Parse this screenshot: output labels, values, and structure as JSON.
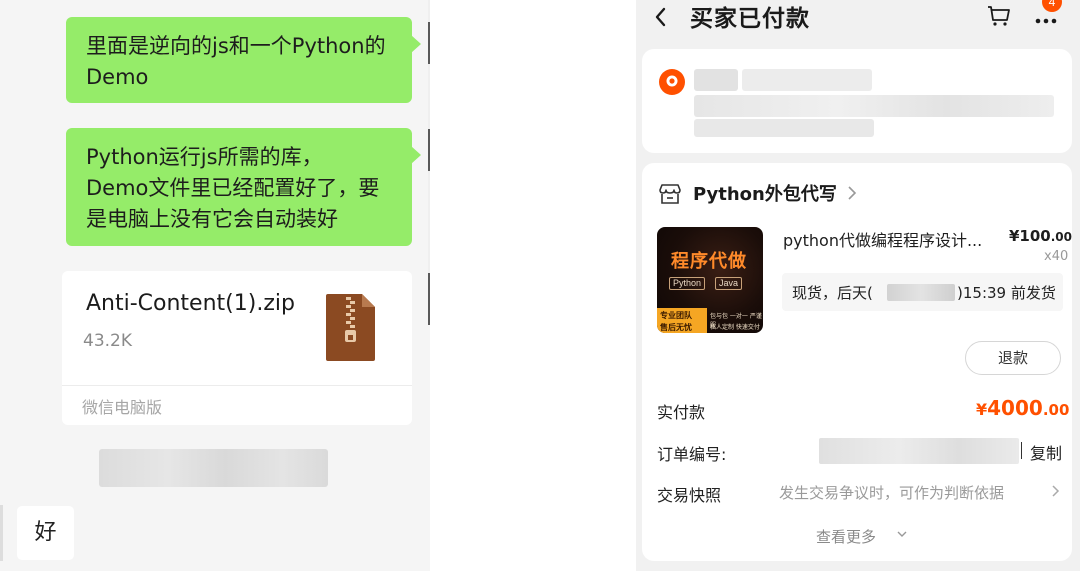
{
  "chat": {
    "message1": "里面是逆向的js和一个Python的Demo",
    "message1_lines": [
      "里面是逆向的js和一个Python的",
      "Demo"
    ],
    "message2_lines": [
      "Python运行js所需的库，",
      "Demo文件里已经配置好了，要",
      "是电脑上没有它会自动装好"
    ],
    "file": {
      "name": "Anti-Content(1).zip",
      "size": "43.2K",
      "source": "微信电脑版",
      "icon": "zip-file-icon"
    },
    "reply": "好"
  },
  "order": {
    "title": "买家已付款",
    "badge_count": "4",
    "store": {
      "name": "Python外包代写",
      "icon": "store-icon"
    },
    "item": {
      "thumbnail": {
        "title": "程序代做",
        "tags": [
          "Python",
          "Java"
        ],
        "bar_lines": [
          "专业团队",
          "售后无忧"
        ],
        "notes": [
          "包与包 一对一 严谨服",
          "私人定制 快速交付"
        ]
      },
      "title": "python代做编程程序设计...",
      "price_main": "¥100",
      "price_dec": ".00",
      "quantity": "x40",
      "shipping_pre": "现货，后天(",
      "shipping_post": ")15:39 前发货"
    },
    "refund_label": "退款",
    "paid": {
      "label": "实付款",
      "currency": "¥",
      "amount": "4000",
      "decimals": ".00"
    },
    "order_no": {
      "label": "订单编号:",
      "copy_label": "复制"
    },
    "snapshot": {
      "label": "交易快照",
      "desc": "发生交易争议时，可作为判断依据"
    },
    "see_more": "查看更多",
    "colors": {
      "accent": "#ff5000",
      "bubble": "#95ec69"
    }
  }
}
